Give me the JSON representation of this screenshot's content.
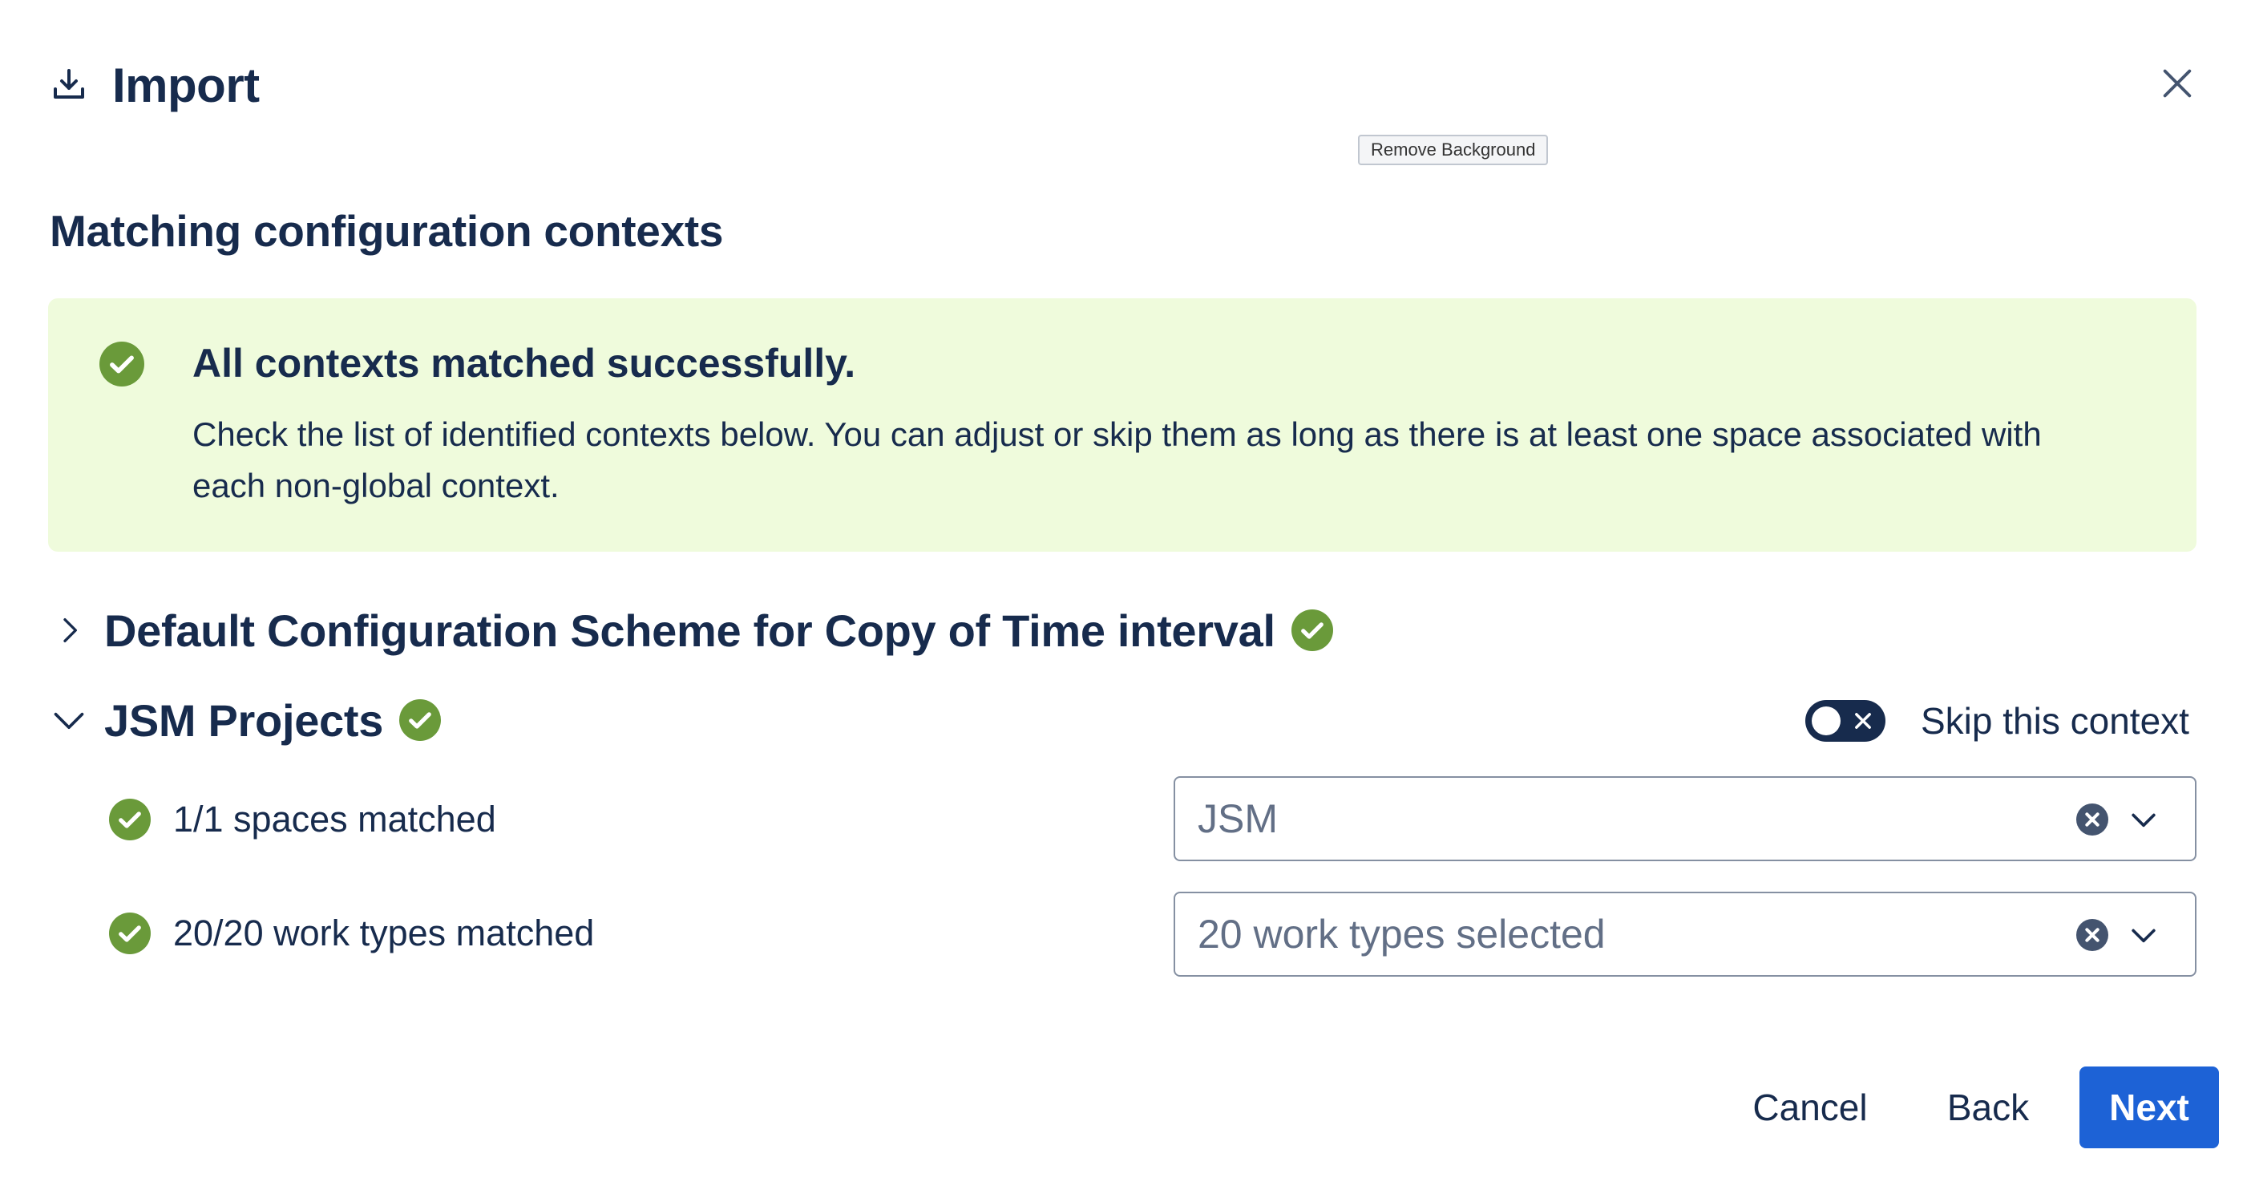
{
  "header": {
    "title": "Import"
  },
  "tooltip": {
    "text": "Remove Background"
  },
  "section": {
    "heading": "Matching configuration contexts"
  },
  "banner": {
    "title": "All contexts matched successfully.",
    "body": "Check the list of identified contexts below. You can adjust or skip them as long as there is at least one space associated with each non-global context."
  },
  "contexts": [
    {
      "title": "Default Configuration Scheme for Copy of Time interval",
      "expanded": false,
      "status": "matched"
    },
    {
      "title": "JSM Projects",
      "expanded": true,
      "status": "matched",
      "skip_label": "Skip this context",
      "skip_toggle_on": false,
      "matches": [
        {
          "label": "1/1 spaces matched",
          "select_value": "JSM"
        },
        {
          "label": "20/20 work types matched",
          "select_value": "20 work types selected"
        }
      ]
    }
  ],
  "footer": {
    "cancel_label": "Cancel",
    "back_label": "Back",
    "next_label": "Next"
  },
  "colors": {
    "success_green": "#6a9a3a",
    "banner_bg": "#effbdc",
    "primary_blue": "#1d62d6",
    "text_dark": "#172b4d"
  },
  "icons": {
    "header_icon": "download-icon",
    "close": "close-icon",
    "status": "check-circle-icon",
    "collapsed": "chevron-right-icon",
    "expanded": "chevron-down-icon",
    "clear": "clear-circle-icon",
    "dropdown": "chevron-down-icon"
  }
}
